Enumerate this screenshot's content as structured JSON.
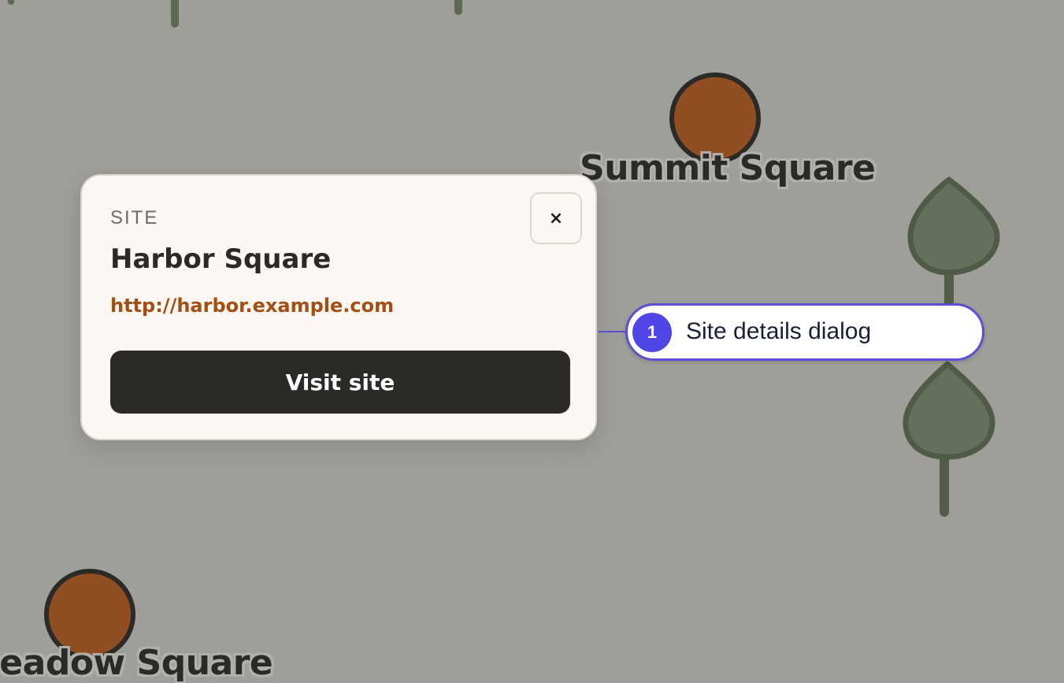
{
  "map": {
    "places": [
      {
        "name": "Summit Square",
        "marker_color": "#914e22"
      },
      {
        "name": "Meadow Square",
        "marker_color": "#914e22"
      }
    ],
    "tree_color": "#647059"
  },
  "dialog": {
    "kicker": "SITE",
    "title": "Harbor Square",
    "url": "http://harbor.example.com",
    "close_label": "×",
    "visit_label": "Visit site"
  },
  "annotation": {
    "number": "1",
    "label": "Site details dialog",
    "accent": "#4f46e5"
  }
}
